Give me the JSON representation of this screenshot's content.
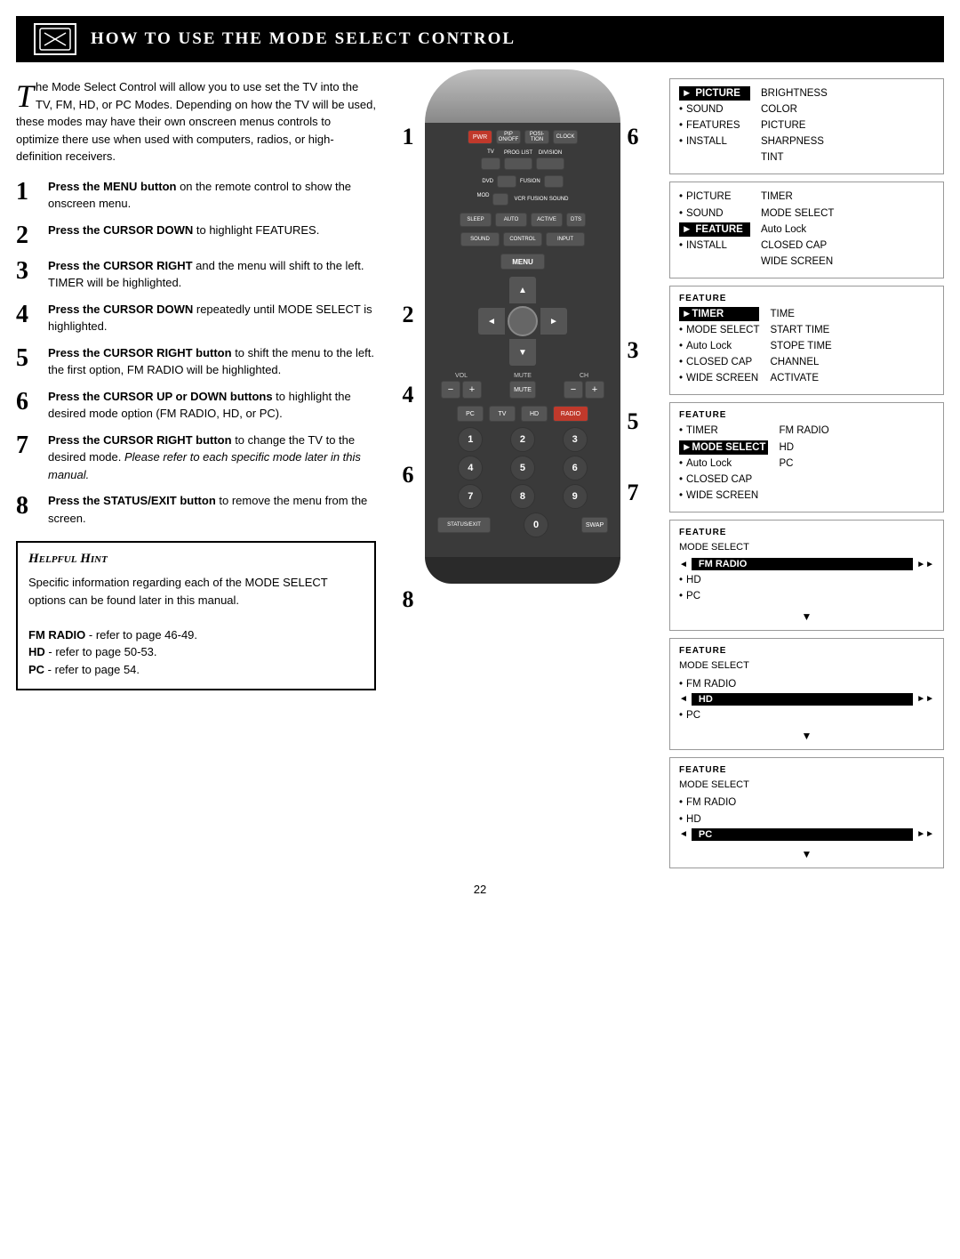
{
  "header": {
    "title": "How to Use the Mode Select Control"
  },
  "intro": {
    "drop_cap": "T",
    "text": "he Mode Select Control will allow you to use set the TV into the TV, FM, HD, or PC Modes. Depending on how the TV will be used, these modes may have their own onscreen menus controls to optimize there use when used with computers, radios, or high-definition receivers."
  },
  "steps": [
    {
      "num": "1",
      "text_parts": [
        {
          "bold": true,
          "text": "Press the MENU button"
        },
        {
          "bold": false,
          "text": " on the remote control to show the onscreen menu."
        }
      ]
    },
    {
      "num": "2",
      "text_parts": [
        {
          "bold": true,
          "text": "Press the CURSOR DOWN"
        },
        {
          "bold": false,
          "text": " to highlight FEATURES."
        }
      ]
    },
    {
      "num": "3",
      "text_parts": [
        {
          "bold": true,
          "text": "Press the CURSOR RIGHT"
        },
        {
          "bold": false,
          "text": " and the menu will shift to the left. TIMER will be highlighted."
        }
      ]
    },
    {
      "num": "4",
      "text_parts": [
        {
          "bold": true,
          "text": "Press the CURSOR DOWN"
        },
        {
          "bold": false,
          "text": " repeatedly until MODE SELECT is highlighted."
        }
      ]
    },
    {
      "num": "5",
      "text_parts": [
        {
          "bold": true,
          "text": "Press the CURSOR RIGHT button"
        },
        {
          "bold": false,
          "text": " to shift the menu to the left. the first option, FM RADIO will be highlighted."
        }
      ]
    },
    {
      "num": "6",
      "text_parts": [
        {
          "bold": true,
          "text": "Press the CURSOR UP or DOWN buttons"
        },
        {
          "bold": false,
          "text": " to highlight the desired mode option (FM RADIO, HD, or PC)."
        }
      ]
    },
    {
      "num": "7",
      "text_parts": [
        {
          "bold": true,
          "text": "Press the CURSOR RIGHT button"
        },
        {
          "bold": false,
          "text": " to change the TV to the desired mode. "
        },
        {
          "bold": false,
          "italic": true,
          "text": "Please refer to each specific mode later in this manual."
        }
      ]
    },
    {
      "num": "8",
      "text_parts": [
        {
          "bold": true,
          "text": "Press the STATUS/EXIT button"
        },
        {
          "bold": false,
          "text": " to remove the menu from the screen."
        }
      ]
    }
  ],
  "hint": {
    "title": "Helpful Hint",
    "body": "Specific information regarding each of the MODE SELECT options can be found later in this manual.",
    "items": [
      {
        "bold": true,
        "text": "FM RADIO",
        "rest": " - refer to page 46-49."
      },
      {
        "bold": true,
        "text": "HD",
        "rest": " - refer to page 50-53."
      },
      {
        "bold": true,
        "text": "PC",
        "rest": " - refer to page 54."
      }
    ]
  },
  "menu_boxes": [
    {
      "label": "",
      "cols": true,
      "left_items": [
        {
          "text": "PICTURE",
          "highlighted": true,
          "arrow": true
        },
        {
          "text": "SOUND",
          "bullet": true
        },
        {
          "text": "FEATURES",
          "bullet": true
        },
        {
          "text": "INSTALL",
          "bullet": true
        }
      ],
      "right_items": [
        {
          "text": "BRIGHTNESS"
        },
        {
          "text": "COLOR"
        },
        {
          "text": "PICTURE"
        },
        {
          "text": "SHARPNESS"
        },
        {
          "text": "TINT"
        }
      ]
    },
    {
      "label": "",
      "cols": true,
      "left_items": [
        {
          "text": "PICTURE",
          "bullet": true
        },
        {
          "text": "SOUND",
          "bullet": true
        },
        {
          "text": "FEATURE",
          "highlighted": true,
          "arrow": true
        },
        {
          "text": "INSTALL",
          "bullet": true
        }
      ],
      "right_items": [
        {
          "text": "TIMER"
        },
        {
          "text": "MODE SELECT"
        },
        {
          "text": "Auto Lock"
        },
        {
          "text": "CLOSED CAP"
        },
        {
          "text": "WIDE SCREEN"
        }
      ]
    },
    {
      "label": "FEATURE",
      "cols": true,
      "left_items": [
        {
          "text": "TIMER",
          "highlighted": true,
          "arrow": true
        },
        {
          "text": "MODE SELECT",
          "bullet": true
        },
        {
          "text": "Auto Lock",
          "bullet": true
        },
        {
          "text": "CLOSED CAP",
          "bullet": true
        },
        {
          "text": "WIDE SCREEN",
          "bullet": true
        }
      ],
      "right_items": [
        {
          "text": "TIME"
        },
        {
          "text": "START TIME"
        },
        {
          "text": "STOPE TIME"
        },
        {
          "text": "CHANNEL"
        },
        {
          "text": "ACTIVATE"
        }
      ]
    },
    {
      "label": "FEATURE",
      "cols": true,
      "left_items": [
        {
          "text": "TIMER",
          "bullet": true
        },
        {
          "text": "MODE SELECT",
          "highlighted": true,
          "arrow": true
        },
        {
          "text": "Auto Lock",
          "bullet": true
        },
        {
          "text": "CLOSED CAP",
          "bullet": true
        },
        {
          "text": "WIDE SCREEN",
          "bullet": true
        }
      ],
      "right_items": [
        {
          "text": "FM RADIO"
        },
        {
          "text": "HD"
        },
        {
          "text": "PC"
        }
      ]
    },
    {
      "label": "FEATURE",
      "cols": false,
      "show_mode_select": true,
      "items": [
        {
          "text": "MODE SELECT",
          "label": true
        },
        {
          "text": "FM RADIO",
          "highlighted": true,
          "arrow_left": true,
          "arrow_right": true
        },
        {
          "text": "HD",
          "bullet": true
        },
        {
          "text": "PC",
          "bullet": true
        }
      ]
    },
    {
      "label": "FEATURE",
      "cols": false,
      "show_mode_select": true,
      "items": [
        {
          "text": "MODE SELECT",
          "label": true
        },
        {
          "text": "FM RADIO",
          "bullet": true
        },
        {
          "text": "HD",
          "highlighted": true,
          "arrow_left": true,
          "arrow_right": true
        },
        {
          "text": "PC",
          "bullet": true
        }
      ]
    },
    {
      "label": "FEATURE",
      "cols": false,
      "show_mode_select": true,
      "items": [
        {
          "text": "MODE SELECT",
          "label": true
        },
        {
          "text": "FM RADIO",
          "bullet": true
        },
        {
          "text": "HD",
          "bullet": true
        },
        {
          "text": "PC",
          "highlighted": true,
          "arrow_left": true,
          "arrow_right": true
        }
      ]
    }
  ],
  "step_numbers_on_remote": [
    "1",
    "2",
    "3",
    "4",
    "5",
    "6",
    "7",
    "8"
  ],
  "page_number": "22"
}
